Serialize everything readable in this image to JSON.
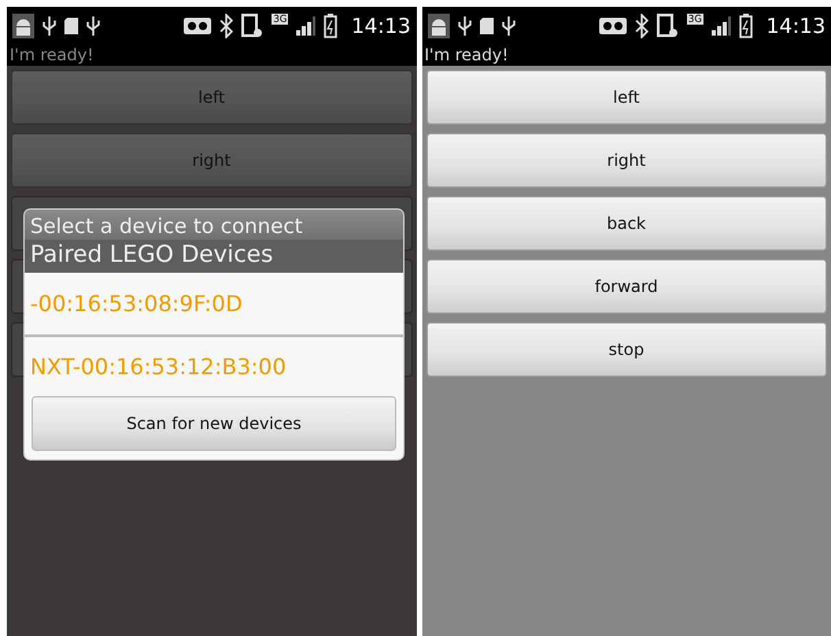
{
  "screens": [
    {
      "dimmed": true,
      "status_bar": {
        "network": "3G",
        "time": "14:13"
      },
      "message": "I'm ready!",
      "buttons": [
        {
          "label": "left",
          "covered": false
        },
        {
          "label": "right",
          "covered": false
        },
        {
          "covered": true
        },
        {
          "covered": true
        },
        {
          "covered": true
        }
      ],
      "dialog": {
        "title": "Select a device to connect",
        "section": "Paired LEGO Devices",
        "devices": [
          "-00:16:53:08:9F:0D",
          "NXT-00:16:53:12:B3:00"
        ],
        "scan_button": "Scan for new devices"
      }
    },
    {
      "dimmed": false,
      "status_bar": {
        "network": "3G",
        "time": "14:13"
      },
      "message": "I'm ready!",
      "buttons": [
        {
          "label": "left"
        },
        {
          "label": "right"
        },
        {
          "label": "back"
        },
        {
          "label": "forward"
        },
        {
          "label": "stop"
        }
      ]
    }
  ]
}
